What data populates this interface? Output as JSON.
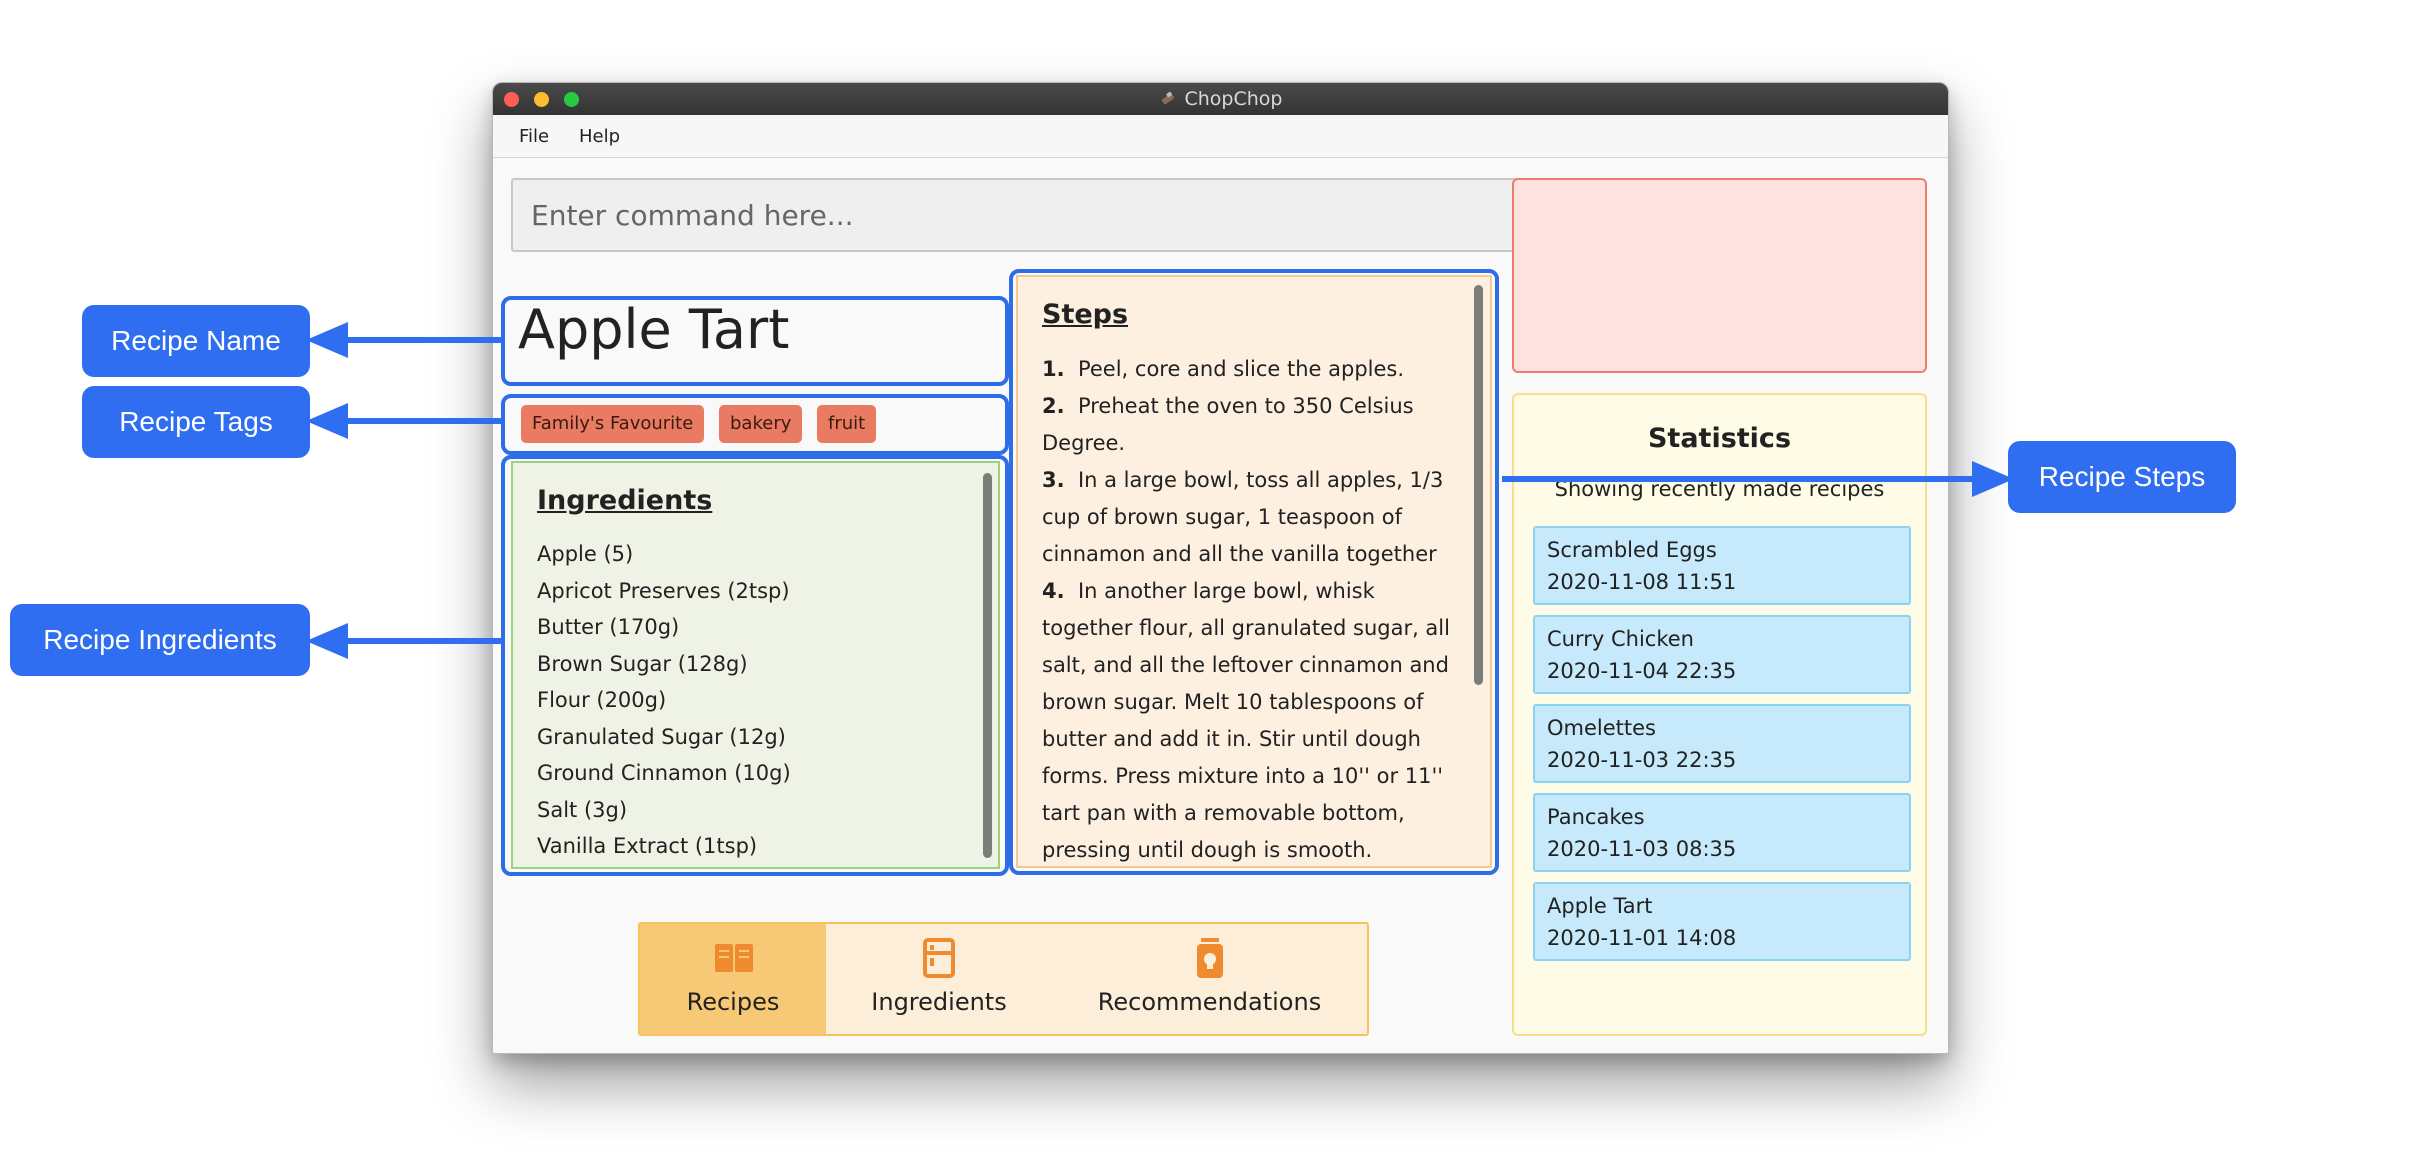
{
  "window": {
    "title": "ChopChop"
  },
  "menu": [
    "File",
    "Help"
  ],
  "command": {
    "placeholder": "Enter command here..."
  },
  "recipe": {
    "name": "Apple Tart",
    "tags": [
      "Family's Favourite",
      "bakery",
      "fruit"
    ],
    "ingredients_heading": "Ingredients",
    "ingredients": [
      "Apple (5)",
      "Apricot Preserves (2tsp)",
      "Butter (170g)",
      "Brown Sugar (128g)",
      "Flour (200g)",
      "Granulated Sugar (12g)",
      "Ground Cinnamon (10g)",
      "Salt (3g)",
      "Vanilla Extract (1tsp)"
    ],
    "steps_heading": "Steps",
    "steps": [
      {
        "num": "1.",
        "text": "Peel, core and slice the apples."
      },
      {
        "num": "2.",
        "text": "Preheat the oven to 350 Celsius Degree."
      },
      {
        "num": "3.",
        "text": "In a large bowl, toss all apples, 1/3 cup of brown sugar, 1 teaspoon of cinnamon and all the vanilla together"
      },
      {
        "num": "4.",
        "text": "In another large bowl, whisk together flour, all granulated sugar, all salt, and all the leftover cinnamon and brown sugar. Melt 10 tablespoons of butter and add it in. Stir until dough forms. Press mixture into a 10'' or 11'' tart pan with a removable bottom, pressing until dough is smooth."
      }
    ]
  },
  "statistics": {
    "title": "Statistics",
    "subtitle": "Showing recently made recipes",
    "items": [
      {
        "name": "Scrambled Eggs",
        "date": "2020-11-08 11:51"
      },
      {
        "name": "Curry Chicken",
        "date": "2020-11-04 22:35"
      },
      {
        "name": "Omelettes",
        "date": "2020-11-03 22:35"
      },
      {
        "name": "Pancakes",
        "date": "2020-11-03 08:35"
      },
      {
        "name": "Apple Tart",
        "date": "2020-11-01 14:08"
      }
    ]
  },
  "tabs": [
    {
      "label": "Recipes",
      "icon": "book-icon",
      "active": true
    },
    {
      "label": "Ingredients",
      "icon": "fridge-icon",
      "active": false
    },
    {
      "label": "Recommendations",
      "icon": "lightbulb-jar-icon",
      "active": false
    }
  ],
  "callouts": {
    "name": "Recipe Name",
    "tags": "Recipe Tags",
    "ingredients": "Recipe Ingredients",
    "steps": "Recipe Steps"
  },
  "colors": {
    "callout": "#2f6ef0",
    "highlight": "#2d6de8",
    "tag": "#e87b61",
    "tab_active": "#f7c875",
    "icon": "#f08a2e"
  }
}
